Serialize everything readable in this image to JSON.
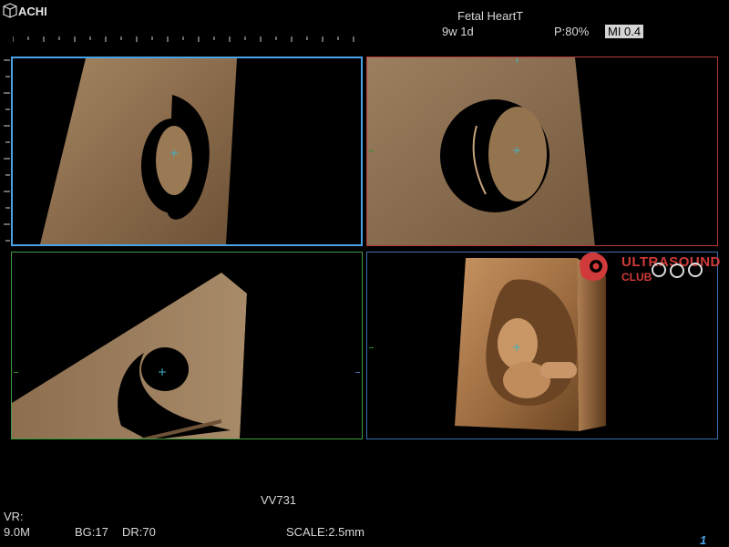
{
  "header": {
    "brand": "ACHI",
    "preset": "Fetal HeartT",
    "gestational_age": "9w 1d",
    "power": "P:80%",
    "mechanical_index": "MI 0.4"
  },
  "watermark": {
    "line1": "ULTRASOUND",
    "line2": "CLUB",
    "color": "#d13a3a"
  },
  "footer": {
    "mode_code": "VV731",
    "vr_label": "VR:",
    "frequency": "9.0M",
    "bg": "BG:17",
    "dr": "DR:70",
    "scale": "SCALE:2.5mm",
    "page_number": "1"
  },
  "panels": [
    {
      "id": "A",
      "plane": "axial",
      "border_color": "#4aa3e6",
      "selected": true
    },
    {
      "id": "B",
      "plane": "sagittal",
      "border_color": "#b3383a",
      "selected": false
    },
    {
      "id": "C",
      "plane": "coronal",
      "border_color": "#3e9a3e",
      "selected": false
    },
    {
      "id": "D",
      "plane": "3d-render",
      "border_color": "#3d6fb0",
      "selected": false
    }
  ]
}
